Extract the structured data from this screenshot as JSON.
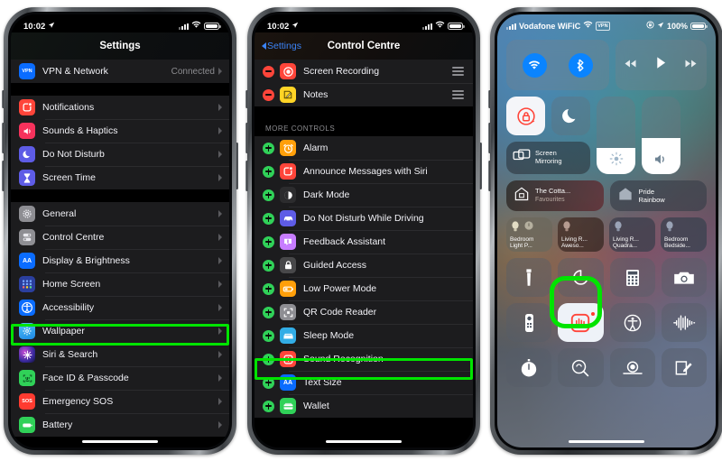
{
  "meta": {
    "accent_highlight": "#00e400",
    "ios_blue": "#0a84ff",
    "list_bg": "#1c1c1e",
    "label_color": "#f2f2f7"
  },
  "phone1": {
    "status": {
      "time": "10:02",
      "location_icon": "location-arrow-icon",
      "signal_icon": "cellular-bars-icon",
      "wifi_icon": "wifi-icon",
      "battery_icon": "battery-full-icon"
    },
    "nav": {
      "title": "Settings"
    },
    "top_group": [
      {
        "label": "VPN & Network",
        "value": "Connected",
        "icon": "vpn-icon",
        "icon_text": "VPN",
        "icon_color": "#0a6cff"
      }
    ],
    "group2": [
      {
        "label": "Notifications",
        "icon": "notifications-icon",
        "icon_color": "#ff453a"
      },
      {
        "label": "Sounds & Haptics",
        "icon": "sounds-haptics-icon",
        "icon_color": "#f6325c"
      },
      {
        "label": "Do Not Disturb",
        "icon": "do-not-disturb-icon",
        "icon_color": "#5e5ce6"
      },
      {
        "label": "Screen Time",
        "icon": "screen-time-icon",
        "icon_color": "#5e5ce6"
      }
    ],
    "group3": [
      {
        "label": "General",
        "icon": "general-gear-icon",
        "icon_color": "#8e8e93"
      },
      {
        "label": "Control Centre",
        "icon": "control-centre-icon",
        "icon_color": "#8e8e93"
      },
      {
        "label": "Display & Brightness",
        "icon": "display-brightness-icon",
        "icon_text": "AA",
        "icon_color": "#0a6cff"
      },
      {
        "label": "Home Screen",
        "icon": "home-screen-icon",
        "icon_color": "#3b5bdb"
      },
      {
        "label": "Accessibility",
        "icon": "accessibility-icon",
        "icon_color": "#0a6cff",
        "highlighted": true
      },
      {
        "label": "Wallpaper",
        "icon": "wallpaper-icon",
        "icon_color": "#32ade6"
      },
      {
        "label": "Siri & Search",
        "icon": "siri-search-icon",
        "icon_color": "#1b1b3a"
      },
      {
        "label": "Face ID & Passcode",
        "icon": "face-id-icon",
        "icon_color": "#30d158"
      },
      {
        "label": "Emergency SOS",
        "icon": "emergency-sos-icon",
        "icon_text": "SOS",
        "icon_color": "#ff3b30"
      },
      {
        "label": "Battery",
        "icon": "battery-icon",
        "icon_color": "#30d158"
      }
    ]
  },
  "phone2": {
    "status": {
      "time": "10:02",
      "location_icon": "location-arrow-icon",
      "signal_icon": "cellular-bars-icon",
      "wifi_icon": "wifi-icon",
      "battery_icon": "battery-full-icon"
    },
    "nav": {
      "back_label": "Settings",
      "title": "Control Centre"
    },
    "included": [
      {
        "label": "Screen Recording",
        "icon": "screen-recording-icon",
        "icon_color": "#ff453a",
        "action": "remove"
      },
      {
        "label": "Notes",
        "icon": "notes-icon",
        "icon_color": "#ffd426",
        "action": "remove"
      }
    ],
    "section_title": "MORE CONTROLS",
    "more_controls": [
      {
        "label": "Alarm",
        "icon": "alarm-clock-icon",
        "icon_color": "#ff9f0a",
        "action": "add"
      },
      {
        "label": "Announce Messages with Siri",
        "icon": "announce-messages-icon",
        "icon_color": "#ff453a",
        "action": "add"
      },
      {
        "label": "Dark Mode",
        "icon": "dark-mode-icon",
        "icon_color": "#1c1c1e",
        "action": "add"
      },
      {
        "label": "Do Not Disturb While Driving",
        "icon": "car-icon",
        "icon_color": "#5e5ce6",
        "action": "add"
      },
      {
        "label": "Feedback Assistant",
        "icon": "feedback-assistant-icon",
        "icon_color": "#c77dff",
        "action": "add"
      },
      {
        "label": "Guided Access",
        "icon": "guided-access-lock-icon",
        "icon_color": "#48484a",
        "action": "add"
      },
      {
        "label": "Low Power Mode",
        "icon": "low-power-mode-icon",
        "icon_color": "#ff9f0a",
        "action": "add"
      },
      {
        "label": "QR Code Reader",
        "icon": "qr-code-reader-icon",
        "icon_color": "#8e8e93",
        "action": "add"
      },
      {
        "label": "Sleep Mode",
        "icon": "sleep-mode-bed-icon",
        "icon_color": "#32ade6",
        "action": "add"
      },
      {
        "label": "Sound Recognition",
        "icon": "sound-recognition-icon",
        "icon_color": "#ff453a",
        "action": "add",
        "highlighted": true
      },
      {
        "label": "Text Size",
        "icon": "text-size-icon",
        "icon_text": "AA",
        "icon_color": "#0a6cff",
        "action": "add"
      },
      {
        "label": "Wallet",
        "icon": "wallet-icon",
        "icon_color": "#30d158",
        "action": "add"
      }
    ]
  },
  "phone3": {
    "status": {
      "signal_icon": "cellular-bars-icon",
      "carrier": "Vodafone WiFiC",
      "wifi_icon": "wifi-icon",
      "vpn_badge": "VPN",
      "orientation_lock_icon": "rotation-lock-icon",
      "location_icon": "location-arrow-icon",
      "battery_percent": "100%",
      "battery_icon": "battery-full-icon"
    },
    "tiles": {
      "wifi": {
        "name": "wifi-toggle",
        "icon": "wifi-icon",
        "state": "on"
      },
      "bluetooth": {
        "name": "bluetooth-toggle",
        "icon": "bluetooth-icon",
        "state": "on"
      },
      "media": {
        "rewind": "rewind-icon",
        "play": "play-icon",
        "forward": "fast-forward-icon"
      },
      "rotation_lock": {
        "icon": "rotation-lock-icon",
        "state": "on"
      },
      "do_not_disturb": {
        "icon": "moon-icon",
        "state": "off"
      },
      "screen_mirroring": {
        "label_line1": "Screen",
        "label_line2": "Mirroring",
        "icon": "screen-mirroring-icon"
      },
      "brightness": {
        "icon": "brightness-icon",
        "level_percent": 34
      },
      "volume": {
        "icon": "volume-icon",
        "level_percent": 46
      },
      "home_scene_1": {
        "title": "The Cotta...",
        "subtitle": "Favourites",
        "icon": "home-outline-icon"
      },
      "home_scene_2": {
        "title": "Pride",
        "subtitle": "Rainbow",
        "icon": "home-filled-icon"
      },
      "bulbs": [
        {
          "line1": "Bedroom",
          "line2": "Light P...",
          "icon": "bulb-icon"
        },
        {
          "line1": "Living R...",
          "line2": "Aweso...",
          "icon": "bulb-icon"
        },
        {
          "line1": "Living R...",
          "line2": "Quadra...",
          "icon": "bulb-icon"
        },
        {
          "line1": "Bedroom",
          "line2": "Bedside...",
          "icon": "bulb-icon"
        }
      ],
      "grid_row_1": [
        "flashlight-icon",
        "timer-icon",
        "calculator-icon",
        "camera-icon"
      ],
      "grid_row_2": [
        "apple-tv-remote-icon",
        "sound-recognition-icon",
        "accessibility-shortcuts-icon",
        "hearing-icon"
      ],
      "grid_row_3": [
        "stopwatch-icon",
        "magnifier-icon",
        "voice-memos-icon",
        "notes-icon"
      ],
      "sound_recognition_highlighted": true,
      "sound_recognition_badge": "listening-badge"
    }
  }
}
